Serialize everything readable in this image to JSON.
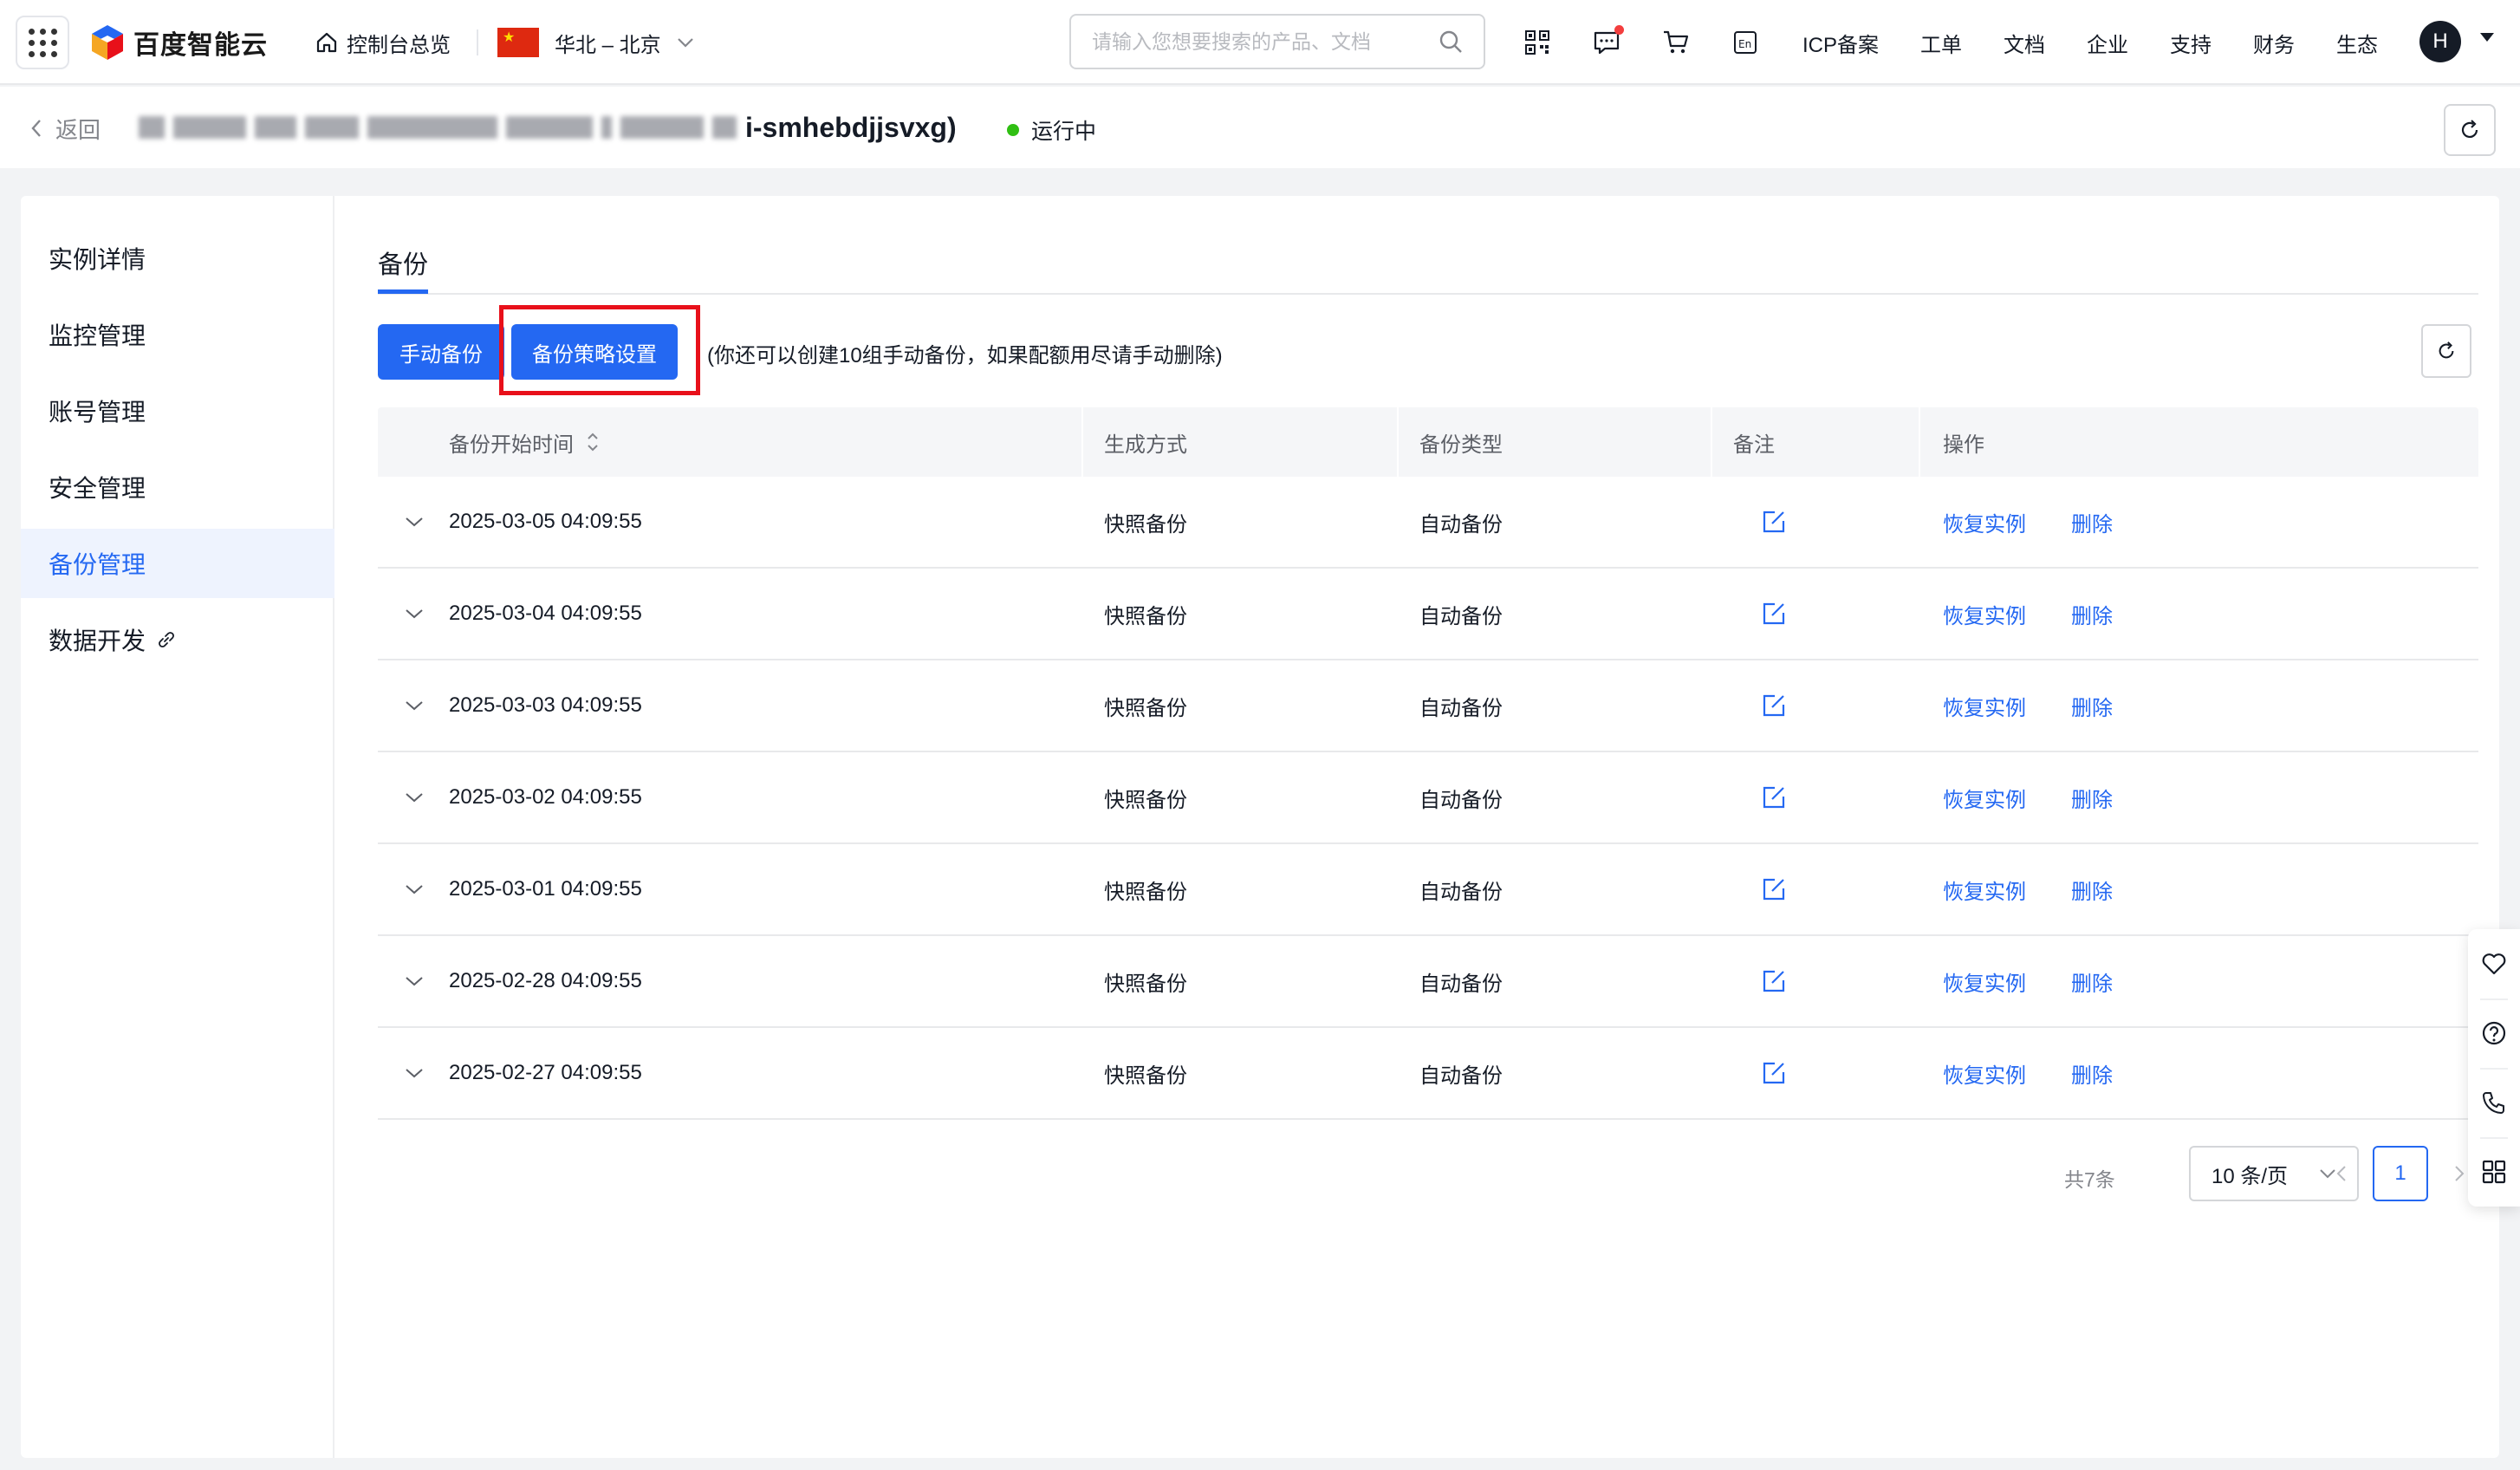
{
  "topbar": {
    "logo_text": "百度智能云",
    "console_label": "控制台总览",
    "region_label": "华北 – 北京",
    "search_placeholder": "请输入您想要搜索的产品、文档",
    "links": [
      "ICP备案",
      "工单",
      "文档",
      "企业",
      "支持",
      "财务",
      "生态"
    ],
    "avatar_letter": "H",
    "icons": [
      "qrcode-icon",
      "message-icon",
      "cart-icon",
      "language-icon"
    ]
  },
  "subheader": {
    "back_label": "返回",
    "instance_name_suffix": "i-smhebdjjsvxg)",
    "status_label": "运行中",
    "status_color": "#30bf13"
  },
  "sidebar": {
    "items": [
      {
        "label": "实例详情"
      },
      {
        "label": "监控管理"
      },
      {
        "label": "账号管理"
      },
      {
        "label": "安全管理"
      },
      {
        "label": "备份管理",
        "active": true
      },
      {
        "label": "数据开发"
      }
    ]
  },
  "content": {
    "tab_label": "备份",
    "manual_backup_label": "手动备份",
    "policy_settings_label": "备份策略设置",
    "hint_text": "(你还可以创建10组手动备份，如果配额用尽请手动删除)",
    "columns": [
      "备份开始时间",
      "生成方式",
      "备份类型",
      "备注",
      "操作"
    ],
    "rows": [
      {
        "time": "2025-03-05 04:09:55",
        "method": "快照备份",
        "type": "自动备份",
        "restore": "恢复实例",
        "delete": "删除"
      },
      {
        "time": "2025-03-04 04:09:55",
        "method": "快照备份",
        "type": "自动备份",
        "restore": "恢复实例",
        "delete": "删除"
      },
      {
        "time": "2025-03-03 04:09:55",
        "method": "快照备份",
        "type": "自动备份",
        "restore": "恢复实例",
        "delete": "删除"
      },
      {
        "time": "2025-03-02 04:09:55",
        "method": "快照备份",
        "type": "自动备份",
        "restore": "恢复实例",
        "delete": "删除"
      },
      {
        "time": "2025-03-01 04:09:55",
        "method": "快照备份",
        "type": "自动备份",
        "restore": "恢复实例",
        "delete": "删除"
      },
      {
        "time": "2025-02-28 04:09:55",
        "method": "快照备份",
        "type": "自动备份",
        "restore": "恢复实例",
        "delete": "删除"
      },
      {
        "time": "2025-02-27 04:09:55",
        "method": "快照备份",
        "type": "自动备份",
        "restore": "恢复实例",
        "delete": "删除"
      }
    ],
    "pagination": {
      "total_label": "共7条",
      "page_size_label": "10 条/页",
      "current_page": "1"
    }
  },
  "colors": {
    "primary": "#2468f2",
    "highlight": "#e8101a",
    "active_bg": "#eef3fe"
  },
  "float_bar": {
    "icons": [
      "favorite-icon",
      "help-icon",
      "phone-icon",
      "apps-icon"
    ]
  }
}
